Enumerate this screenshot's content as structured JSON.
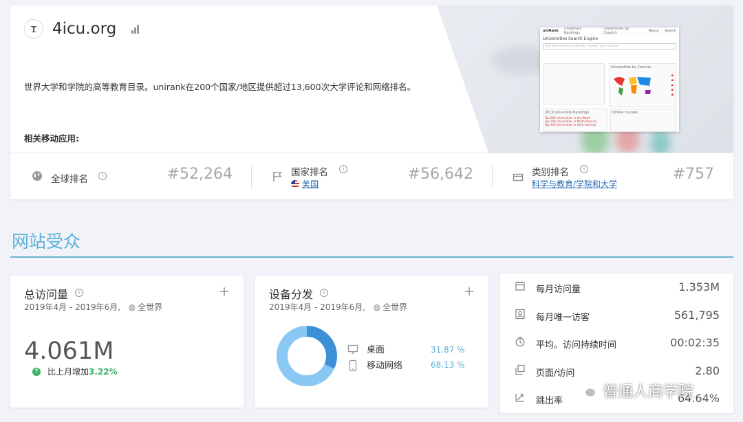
{
  "site": {
    "domain": "4icu.org",
    "description": "世界大学和学院的高等教育目录。unirank在200个国家/地区提供超过13,600次大学评论和网络排名。",
    "apps_label": "相关移动应用:",
    "logo_icon": "university-seal-icon"
  },
  "preview": {
    "logo": "uniRank",
    "nav": [
      "University Rankings",
      "Universities by Country",
      "About"
    ],
    "nav_right": "Search",
    "title": "Universities Search Engine",
    "search_placeholder": "Type the name of a university / school / city / country",
    "panel_country": "Universities by Country",
    "panel_rankings": "2019 University Rankings",
    "panel_online": "Online courses",
    "rank_items": [
      "Top 200 Universities in the World",
      "Top 100 Universities in North America",
      "Top 100 Universities in Latin America"
    ]
  },
  "ranks": {
    "global": {
      "label": "全球排名",
      "value": "#52,264"
    },
    "country": {
      "label": "国家排名",
      "value": "#56,642",
      "link": "美国"
    },
    "category": {
      "label": "类别排名",
      "value": "#757",
      "link": "科学与教育/学院和大学"
    }
  },
  "section": {
    "title": "网站受众"
  },
  "total_visits": {
    "title": "总访问量",
    "period": "2019年4月 - 2019年6月,",
    "region": "全世界",
    "value": "4.061M",
    "growth_label": "比上月增加",
    "growth_value": "3.22%"
  },
  "device": {
    "title": "设备分发",
    "period": "2019年4月 - 2019年6月,",
    "region": "全世界",
    "items": [
      {
        "label": "桌面",
        "pct_text": "31.87 %",
        "pct": 31.87,
        "color": "#3d8fd6",
        "icon": "desktop-icon"
      },
      {
        "label": "移动网络",
        "pct_text": "68.13 %",
        "pct": 68.13,
        "color": "#88c8f2",
        "icon": "mobile-icon"
      }
    ]
  },
  "metrics": [
    {
      "label": "每月访问量",
      "value": "1.353M",
      "icon": "calendar-icon"
    },
    {
      "label": "每月唯一访客",
      "value": "561,795",
      "icon": "user-card-icon"
    },
    {
      "label": "平均。访问持续时间",
      "value": "00:02:35",
      "icon": "clock-icon"
    },
    {
      "label": "页面/访问",
      "value": "2.80",
      "icon": "pages-icon"
    },
    {
      "label": "跳出率",
      "value": "64.64%",
      "icon": "bounce-arrow-icon"
    }
  ],
  "watermark": {
    "text": "普通人商学院"
  },
  "colors": {
    "accent": "#5ab0d8",
    "positive": "#3ab56a",
    "link": "#2a6db5"
  }
}
